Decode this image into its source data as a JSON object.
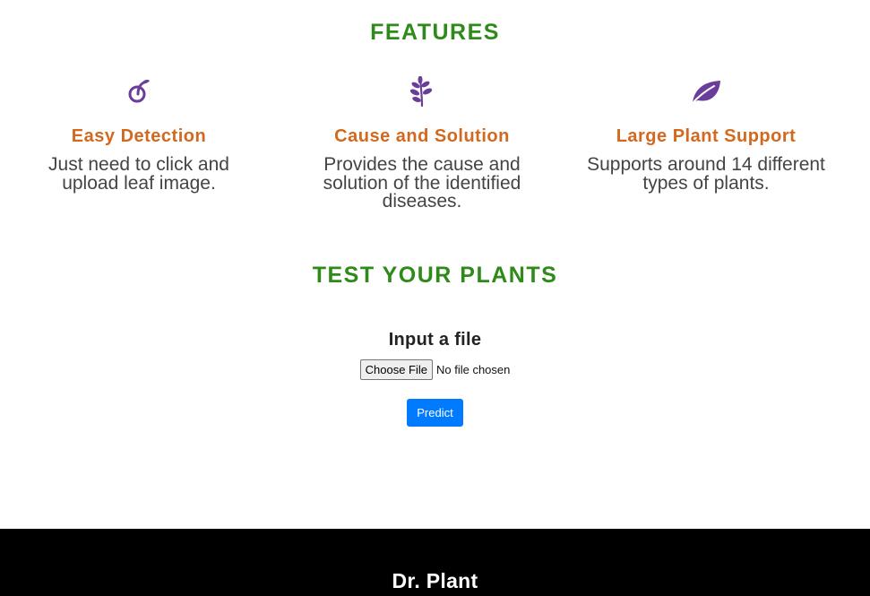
{
  "features": {
    "title": "FEATURES",
    "items": [
      {
        "icon": "seed-icon",
        "title": "Easy Detection",
        "description": "Just need to click and upload leaf image."
      },
      {
        "icon": "herb-icon",
        "title": "Cause and Solution",
        "description": "Provides the cause and solution of the identified diseases."
      },
      {
        "icon": "leaf-icon",
        "title": "Large Plant Support",
        "description": "Supports around 14 different types of plants."
      }
    ],
    "icon_color": "#6a3d9a",
    "title_color": "#d2691e"
  },
  "test_section": {
    "title": "TEST YOUR PLANTS",
    "input_label": "Input a file",
    "choose_file_label": "Choose File",
    "file_status": "No file chosen",
    "predict_label": "Predict"
  },
  "footer": {
    "brand": "Dr. Plant"
  },
  "colors": {
    "heading_green": "#2e8b1a",
    "primary_button": "#007bff",
    "footer_bg": "#000000"
  }
}
